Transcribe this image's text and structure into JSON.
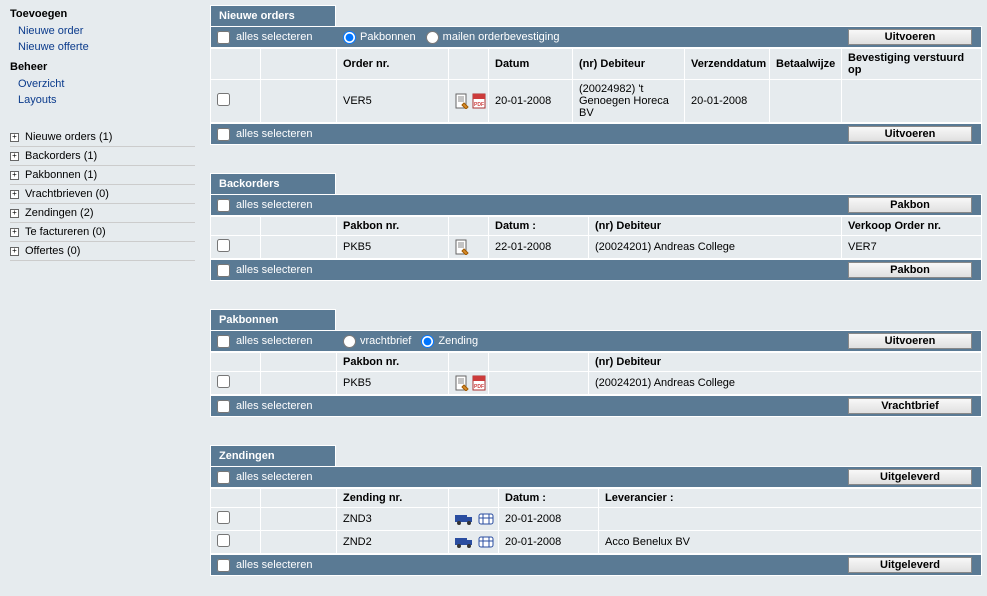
{
  "sidebar": {
    "headings": {
      "add": "Toevoegen",
      "manage": "Beheer"
    },
    "addLinks": {
      "newOrder": "Nieuwe order",
      "newQuote": "Nieuwe offerte"
    },
    "manageLinks": {
      "overview": "Overzicht",
      "layouts": "Layouts"
    },
    "items": [
      {
        "label": "Nieuwe orders (1)"
      },
      {
        "label": "Backorders (1)"
      },
      {
        "label": "Pakbonnen (1)"
      },
      {
        "label": "Vrachtbrieven (0)"
      },
      {
        "label": "Zendingen (2)"
      },
      {
        "label": "Te factureren (0)"
      },
      {
        "label": "Offertes (0)"
      }
    ]
  },
  "common": {
    "selectAll": "alles selecteren"
  },
  "panels": {
    "nieuweOrders": {
      "title": "Nieuwe orders",
      "radio": {
        "pakbonnen": "Pakbonnen",
        "mailOrder": "mailen orderbevestiging"
      },
      "btnTop": "Uitvoeren",
      "btnBottom": "Uitvoeren",
      "headers": {
        "orderNr": "Order nr.",
        "datum": "Datum",
        "debiteur": "(nr) Debiteur",
        "verzend": "Verzenddatum",
        "betaal": "Betaalwijze",
        "bevest": "Bevestiging verstuurd op"
      },
      "rows": [
        {
          "orderNr": "VER5",
          "datum": "20-01-2008",
          "debiteur": "(20024982) 't Genoegen Horeca BV",
          "verzend": "20-01-2008",
          "betaal": "",
          "bevest": ""
        }
      ]
    },
    "backorders": {
      "title": "Backorders",
      "btnTop": "Pakbon",
      "btnBottom": "Pakbon",
      "headers": {
        "pakbonNr": "Pakbon nr.",
        "datum": "Datum :",
        "debiteur": "(nr) Debiteur",
        "verkoop": "Verkoop Order nr."
      },
      "rows": [
        {
          "pakbonNr": "PKB5",
          "datum": "22-01-2008",
          "debiteur": "(20024201) Andreas College",
          "verkoop": "VER7"
        }
      ]
    },
    "pakbonnen": {
      "title": "Pakbonnen",
      "radio": {
        "vrachtbrief": "vrachtbrief",
        "zending": "Zending"
      },
      "btnTop": "Uitvoeren",
      "btnBottom": "Vrachtbrief",
      "headers": {
        "pakbonNr": "Pakbon nr.",
        "debiteur": "(nr) Debiteur"
      },
      "rows": [
        {
          "pakbonNr": "PKB5",
          "debiteur": "(20024201) Andreas College"
        }
      ]
    },
    "zendingen": {
      "title": "Zendingen",
      "btnTop": "Uitgeleverd",
      "btnBottom": "Uitgeleverd",
      "headers": {
        "zendingNr": "Zending nr.",
        "datum": "Datum :",
        "leverancier": "Leverancier :"
      },
      "rows": [
        {
          "zendingNr": "ZND3",
          "datum": "20-01-2008",
          "leverancier": ""
        },
        {
          "zendingNr": "ZND2",
          "datum": "20-01-2008",
          "leverancier": "Acco Benelux BV"
        }
      ]
    }
  }
}
